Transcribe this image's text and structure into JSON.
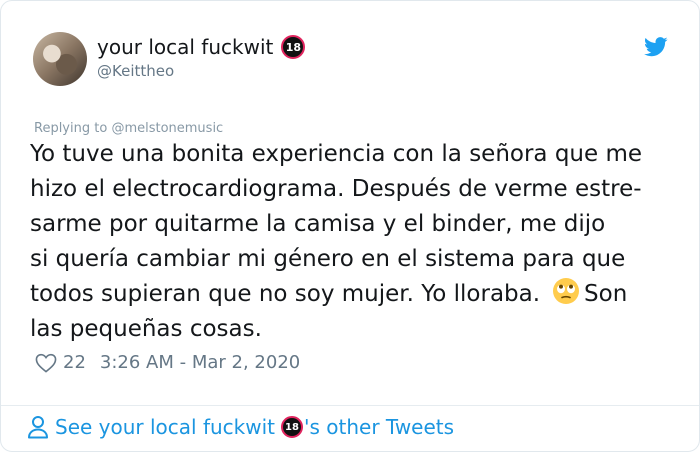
{
  "user": {
    "display_name": "your local fuckwit",
    "badge": "18",
    "handle": "@Keittheo"
  },
  "tweet": {
    "replying_prefix": "Replying to",
    "replying_to": "@melstonemusic",
    "body_line1": "Yo tuve una bonita experiencia con la señora que me",
    "body_line2": "hizo el electrocardiograma. Después de verme estre-",
    "body_line3": "sarme por quitarme la camisa y el binder, me dijo",
    "body_line4": "si quería cambiar mi género en el sistema para que",
    "body_line5_a": "todos supieran que no soy mujer. Yo lloraba.",
    "body_line5_b": "Son",
    "body_line6": "las pequeñas cosas.",
    "emoji": "rolling-eyes-emoji",
    "likes": "22",
    "timestamp": "3:26 AM - Mar 2, 2020"
  },
  "footer": {
    "prefix": "See your local fuckwit",
    "badge": "18",
    "suffix": "'s other Tweets"
  },
  "colors": {
    "accent": "#1b95e0",
    "twitter_blue": "#1da1f2",
    "muted": "#657786",
    "badge_ring": "#e0245e"
  }
}
